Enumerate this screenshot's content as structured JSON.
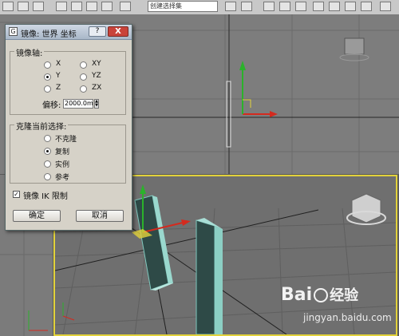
{
  "toolbar": {
    "named_selection_placeholder": "创建选择集",
    "colors": {
      "bg": "#c8c8c8"
    }
  },
  "dialog": {
    "title": "镜像: 世界 坐标",
    "help_label": "?",
    "close_label": "X",
    "mirror_axis": {
      "label": "镜像轴:",
      "options": [
        "X",
        "Y",
        "Z",
        "XY",
        "YZ",
        "ZX"
      ],
      "selected": "Y",
      "offset_label": "偏移:",
      "offset_value": "2000.0mm"
    },
    "clone": {
      "label": "克隆当前选择:",
      "options": [
        "不克隆",
        "复制",
        "实例",
        "参考"
      ],
      "selected": "复制"
    },
    "mirror_ik": {
      "label": "镜像 IK 限制",
      "checked": true
    },
    "ok_label": "确定",
    "cancel_label": "取消"
  },
  "watermark": {
    "logo": "Bai",
    "logo_suffix": "经验",
    "url": "jingyan.baidu.com"
  },
  "colors": {
    "active_viewport_border": "#e2d23b",
    "gizmo_x": "#d42a1e",
    "gizmo_y": "#2bb22b",
    "object": "#2e4a47"
  }
}
